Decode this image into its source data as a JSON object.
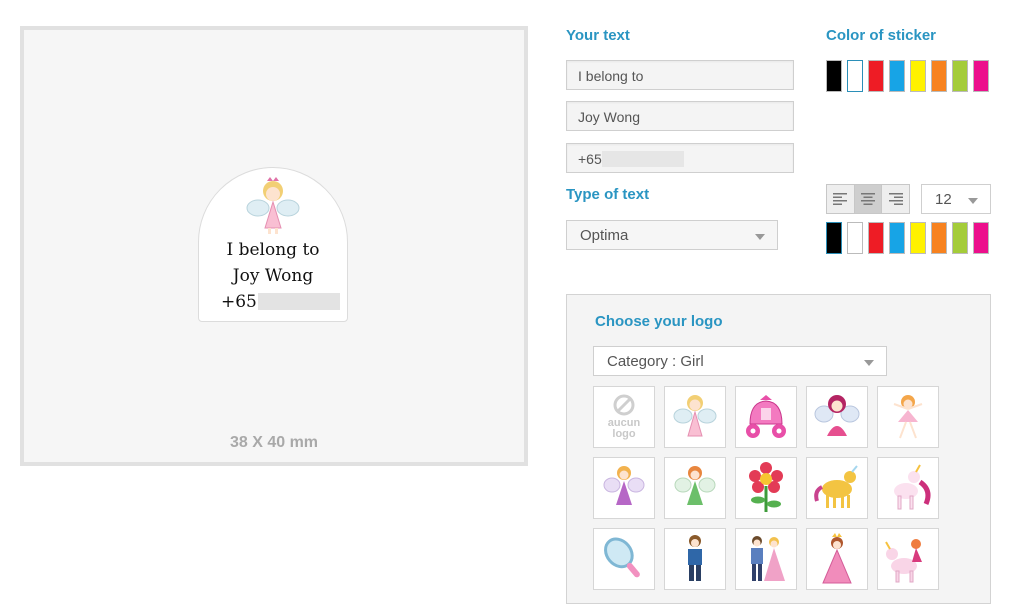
{
  "preview": {
    "sticker_lines": [
      "I belong to",
      "Joy Wong",
      "+65"
    ],
    "dimensions": "38 X 40 mm"
  },
  "text_section": {
    "title": "Your text",
    "fields": [
      {
        "value": "I belong to"
      },
      {
        "value": "Joy Wong"
      },
      {
        "value": "+65"
      }
    ]
  },
  "sticker_color": {
    "title": "Color of sticker",
    "swatches": [
      "#000000",
      "#ffffff",
      "#ee1c25",
      "#17a4e6",
      "#fff200",
      "#f7821f",
      "#a4cc39",
      "#ec0f8c"
    ],
    "selected": "#ffffff"
  },
  "text_type": {
    "title": "Type of text",
    "font_value": "Optima",
    "size_value": "12",
    "alignment_options": [
      "left",
      "center",
      "right"
    ],
    "alignment_selected": "center",
    "text_colors": [
      "#000000",
      "#ffffff",
      "#ee1c25",
      "#17a4e6",
      "#fff200",
      "#f7821f",
      "#a4cc39",
      "#ec0f8c"
    ],
    "selected_text_color": "#000000"
  },
  "logo": {
    "title": "Choose your logo",
    "category_select": "Category : Girl",
    "no_logo_label": "aucun logo",
    "tiles": [
      "no-logo",
      "fairy",
      "carriage",
      "fairy-sitting",
      "ballerina",
      "fairy-purple",
      "fairy-green",
      "flower",
      "unicorn-yellow",
      "unicorn-pink",
      "mirror",
      "prince",
      "prince-princess",
      "princess",
      "unicorn-girl"
    ]
  }
}
